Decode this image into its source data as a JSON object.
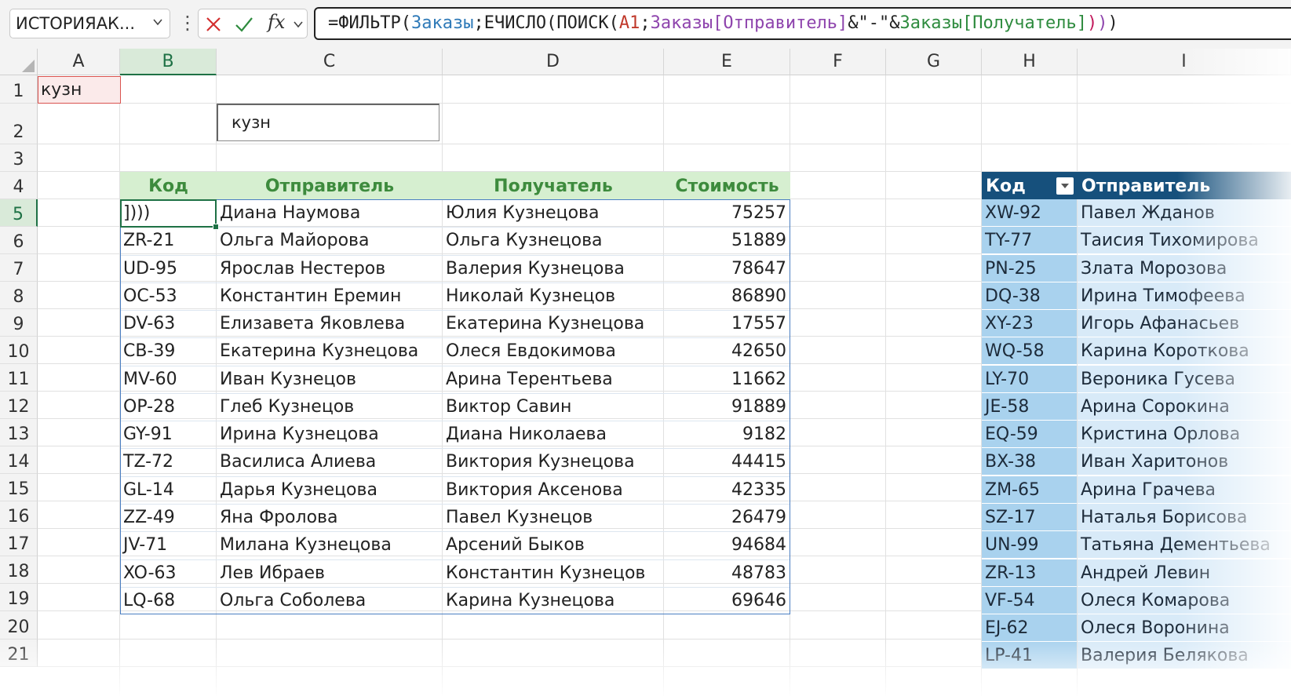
{
  "name_box": "ИСТОРИЯАК...",
  "formula": {
    "parts": [
      {
        "t": "=ФИЛЬТР(",
        "c": ""
      },
      {
        "t": "Заказы",
        "c": "t-blue"
      },
      {
        "t": ";ЕЧИСЛО(ПОИСК(",
        "c": ""
      },
      {
        "t": "A1",
        "c": "t-red"
      },
      {
        "t": ";",
        "c": ""
      },
      {
        "t": "Заказы[Отправитель]",
        "c": "t-purple"
      },
      {
        "t": "&\"-\"&",
        "c": ""
      },
      {
        "t": "Заказы[Получатель]",
        "c": "t-green"
      },
      {
        "t": ")",
        "c": "t-pink"
      },
      {
        "t": ")",
        "c": "t-purple"
      },
      {
        "t": ")",
        "c": ""
      }
    ]
  },
  "columns": [
    "A",
    "B",
    "C",
    "D",
    "E",
    "F",
    "G",
    "H",
    "I"
  ],
  "rows": [
    "1",
    "2",
    "3",
    "4",
    "5",
    "6",
    "7",
    "8",
    "9",
    "10",
    "11",
    "12",
    "13",
    "14",
    "15",
    "16",
    "17",
    "18",
    "19",
    "20",
    "21"
  ],
  "a1_value": "кузн",
  "input_box_value": "кузн",
  "main_table": {
    "headers": [
      "Код",
      "Отправитель",
      "Получатель",
      "Стоимость"
    ],
    "rows": [
      [
        "])))",
        "Диана Наумова",
        "Юлия Кузнецова",
        "75257"
      ],
      [
        "ZR-21",
        "Ольга Майорова",
        "Ольга Кузнецова",
        "51889"
      ],
      [
        "UD-95",
        "Ярослав Нестеров",
        "Валерия Кузнецова",
        "78647"
      ],
      [
        "OC-53",
        "Константин Еремин",
        "Николай Кузнецов",
        "86890"
      ],
      [
        "DV-63",
        "Елизавета Яковлева",
        "Екатерина Кузнецова",
        "17557"
      ],
      [
        "CB-39",
        "Екатерина Кузнецова",
        "Олеся Евдокимова",
        "42650"
      ],
      [
        "MV-60",
        "Иван Кузнецов",
        "Арина Терентьева",
        "11662"
      ],
      [
        "OP-28",
        "Глеб Кузнецов",
        "Виктор Савин",
        "91889"
      ],
      [
        "GY-91",
        "Ирина Кузнецова",
        "Диана Николаева",
        "9182"
      ],
      [
        "TZ-72",
        "Василиса Алиева",
        "Виктория Кузнецова",
        "44415"
      ],
      [
        "GL-14",
        "Дарья Кузнецова",
        "Виктория Аксенова",
        "42335"
      ],
      [
        "ZZ-49",
        "Яна Фролова",
        "Павел Кузнецов",
        "26479"
      ],
      [
        "JV-71",
        "Милана Кузнецова",
        "Арсений Быков",
        "94684"
      ],
      [
        "XO-63",
        "Лев Ибраев",
        "Константин Кузнецов",
        "48783"
      ],
      [
        "LQ-68",
        "Ольга Соболева",
        "Карина Кузнецова",
        "69646"
      ]
    ]
  },
  "orders_table": {
    "headers": [
      "Код",
      "Отправитель"
    ],
    "rows": [
      [
        "XW-92",
        "Павел Жданов"
      ],
      [
        "TY-77",
        "Таисия Тихомирова"
      ],
      [
        "PN-25",
        "Злата Морозова"
      ],
      [
        "DQ-38",
        "Ирина Тимофеева"
      ],
      [
        "XY-23",
        "Игорь Афанасьев"
      ],
      [
        "WQ-58",
        "Карина Короткова"
      ],
      [
        "LY-70",
        "Вероника Гусева"
      ],
      [
        "JE-58",
        "Арина Сорокина"
      ],
      [
        "EQ-59",
        "Кристина Орлова"
      ],
      [
        "BX-38",
        "Иван Харитонов"
      ],
      [
        "ZM-65",
        "Арина Грачева"
      ],
      [
        "SZ-17",
        "Наталья Борисова"
      ],
      [
        "UN-99",
        "Татьяна Дементьева"
      ],
      [
        "ZR-13",
        "Андрей Левин"
      ],
      [
        "VF-54",
        "Олеся Комарова"
      ],
      [
        "EJ-62",
        "Олеся Воронина"
      ],
      [
        "LP-41",
        "Валерия Белякова"
      ]
    ]
  },
  "colors": {
    "accent": "#1e7145",
    "table_header_bg": "#d6efd0",
    "table_header_text": "#3d8b3d",
    "orders_header_bg": "#16507c"
  }
}
